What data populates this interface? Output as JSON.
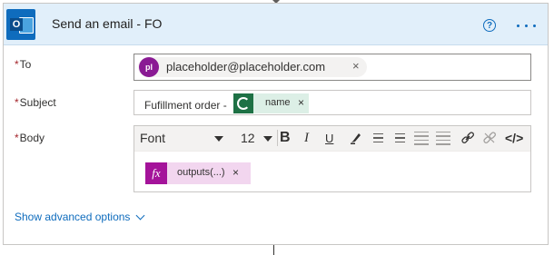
{
  "card": {
    "title": "Send an email - FO",
    "help_glyph": "?",
    "app_icon_letter": "O",
    "icons": [
      "outlook-icon",
      "help-icon",
      "more-options-icon"
    ]
  },
  "fields": {
    "to": {
      "label": "To",
      "required": "*",
      "recipient": {
        "initials": "pl",
        "email": "placeholder@placeholder.com",
        "remove": "×"
      }
    },
    "subject": {
      "label": "Subject",
      "required": "*",
      "prefix": "Fufillment order -",
      "token": {
        "label": "name",
        "remove": "×",
        "icon": "dataverse-icon"
      }
    },
    "body": {
      "label": "Body",
      "required": "*",
      "toolbar": {
        "font": "Font",
        "size": "12",
        "bold": "B",
        "italic": "I",
        "underline": "U",
        "code": "</>"
      },
      "token": {
        "label": "outputs(...)",
        "remove": "×",
        "fx": "fx"
      }
    }
  },
  "advanced": {
    "label": "Show advanced options"
  },
  "colors": {
    "header": "#e1effa",
    "accent": "#0f6cbd",
    "required": "#a4262c",
    "avatar": "#8a1a94",
    "fx": "#a4139a",
    "dataverse": "#1e7145"
  }
}
